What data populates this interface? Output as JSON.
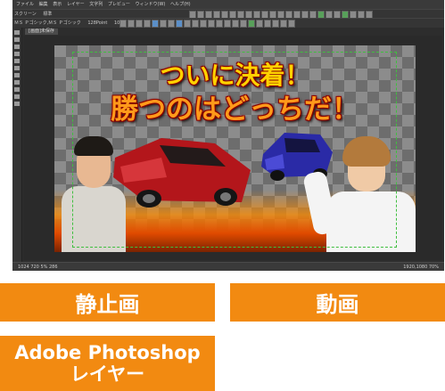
{
  "menubar": {
    "items": [
      "ファイル",
      "編集",
      "表示",
      "レイヤー",
      "文字列",
      "プレビュー",
      "ウィンドウ(W)",
      "ヘルプ(H)"
    ]
  },
  "toolbar": {
    "doc_mode": "スクリーン",
    "doc_mode2": "標準",
    "font_name": "ＭＳ Ｐゴシック,ＭＳ Ｐゴシック",
    "font_size": "128Point",
    "scale": "100%"
  },
  "document": {
    "tab_label": "[画面]未保存"
  },
  "canvas": {
    "headline_line1": "ついに決着！",
    "headline_line2": "勝つのはどっちだ！"
  },
  "statusbar": {
    "left": "1024   720   5%   286",
    "right": "1920,1080    70%"
  },
  "labels": {
    "still_image": "静止画",
    "video": "動画",
    "psd_line1": "Adobe Photoshop",
    "psd_line2": "レイヤー"
  },
  "colors": {
    "label_orange": "#f28a11",
    "headline_yellow": "#ffd200",
    "headline_orange": "#ff9a1a",
    "guide_green": "#3fbf3f"
  }
}
